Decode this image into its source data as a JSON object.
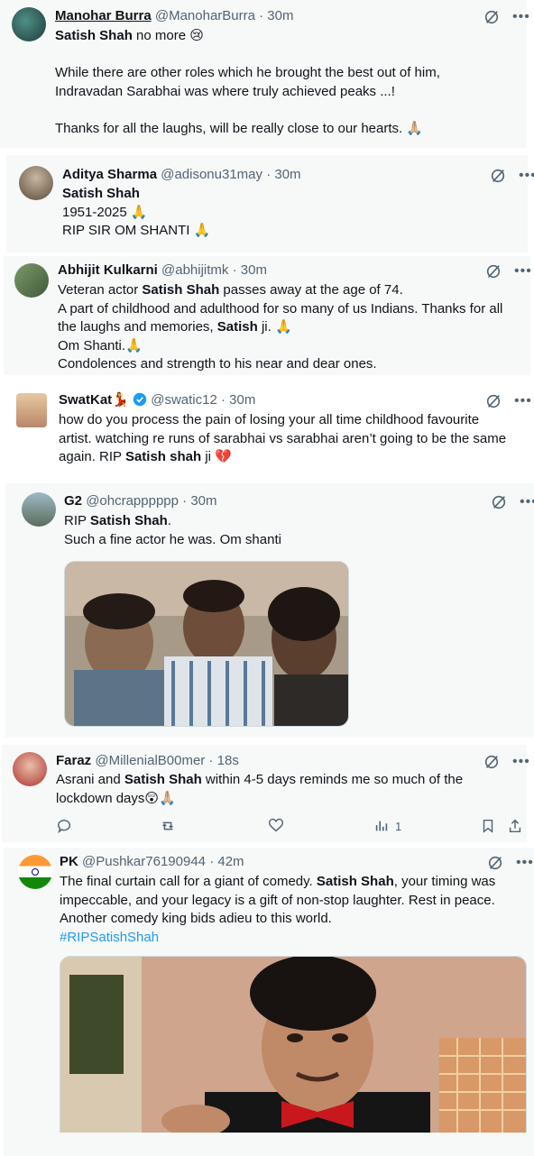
{
  "tweets": [
    {
      "name": "Manohar Burra",
      "handle": "@ManoharBurra",
      "time": "· 30m",
      "lines": [
        {
          "b": "Satish Shah",
          "t": " no more 😢"
        },
        {
          "t": ""
        },
        {
          "t": "While there are other roles which he brought the best out of him,"
        },
        {
          "t": "Indravadan Sarabhai was where truly achieved peaks ...!"
        },
        {
          "t": ""
        },
        {
          "t": "Thanks for all the laughs, will be really close to our hearts. 🙏🏼"
        }
      ]
    },
    {
      "name": "Aditya Sharma",
      "handle": "@adisonu31may",
      "time": "· 30m",
      "lines": [
        {
          "b": "Satish Shah",
          "t": ""
        },
        {
          "t": "1951-2025 🙏"
        },
        {
          "t": "RIP SIR OM SHANTI 🙏"
        }
      ]
    },
    {
      "name": "Abhijit Kulkarni",
      "handle": "@abhijitmk",
      "time": "· 30m",
      "lines": [
        {
          "t": "Veteran actor ",
          "b": "Satish Shah",
          "t2": " passes away at the age of 74."
        },
        {
          "t": "A part of childhood and adulthood for so many of us Indians. Thanks for all"
        },
        {
          "t": "the laughs and memories, ",
          "b": "Satish",
          "t2": " ji. 🙏"
        },
        {
          "t": "Om Shanti.🙏"
        },
        {
          "t": "Condolences and strength to his near and dear ones."
        }
      ]
    },
    {
      "name": "SwatKat",
      "name_emoji": "💃",
      "handle": "@swatic12",
      "time": "· 30m",
      "lines": [
        {
          "t": "how do you process the pain of losing your all time childhood favourite"
        },
        {
          "t": "artist. watching re runs of sarabhai vs sarabhai aren’t going to be the same"
        },
        {
          "t": "again. RIP ",
          "b": "Satish shah",
          "t2": " ji 💔"
        }
      ]
    },
    {
      "name": "G2",
      "handle": "@ohcrapppppp",
      "time": "· 30m",
      "lines": [
        {
          "t": "RIP ",
          "b": "Satish Shah",
          "t2": "."
        },
        {
          "t": "Such a fine actor he was. Om shanti"
        }
      ]
    },
    {
      "name": "Faraz",
      "handle": "@MillenialB00mer",
      "time": "· 18s",
      "lines": [
        {
          "t": "Asrani and ",
          "b": "Satish Shah",
          "t2": " within 4-5 days reminds me so much of the"
        },
        {
          "t": "lockdown days😲🙏🏼"
        }
      ],
      "views": "1"
    },
    {
      "name": "PK",
      "handle": "@Pushkar76190944",
      "time": "· 42m",
      "lines": [
        {
          "t": "The final curtain call for a giant of comedy. ",
          "b": "Satish Shah",
          "t2": ", your timing was"
        },
        {
          "t": "impeccable, and your legacy is a gift of non-stop laughter. Rest in peace."
        },
        {
          "t": "Another comedy king bids adieu to this world."
        }
      ],
      "hashtag": "#RIPSatishShah"
    }
  ],
  "colors": {
    "accent": "#1d9bf0",
    "muted": "#536471",
    "bg": "#f7f9f9"
  }
}
